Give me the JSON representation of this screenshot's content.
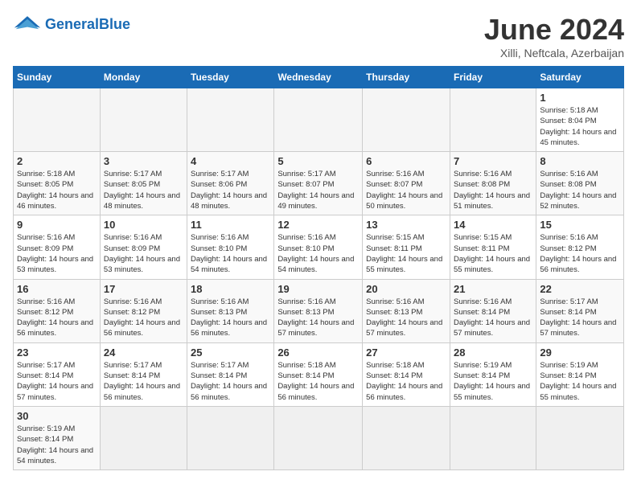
{
  "logo": {
    "text_general": "General",
    "text_blue": "Blue"
  },
  "title": "June 2024",
  "subtitle": "Xilli, Neftcala, Azerbaijan",
  "days_of_week": [
    "Sunday",
    "Monday",
    "Tuesday",
    "Wednesday",
    "Thursday",
    "Friday",
    "Saturday"
  ],
  "weeks": [
    [
      {
        "day": "",
        "empty": true
      },
      {
        "day": "",
        "empty": true
      },
      {
        "day": "",
        "empty": true
      },
      {
        "day": "",
        "empty": true
      },
      {
        "day": "",
        "empty": true
      },
      {
        "day": "",
        "empty": true
      },
      {
        "day": "1",
        "sunrise": "5:18 AM",
        "sunset": "8:04 PM",
        "daylight": "14 hours and 45 minutes."
      }
    ],
    [
      {
        "day": "2",
        "sunrise": "5:18 AM",
        "sunset": "8:05 PM",
        "daylight": "14 hours and 46 minutes."
      },
      {
        "day": "3",
        "sunrise": "5:17 AM",
        "sunset": "8:05 PM",
        "daylight": "14 hours and 48 minutes."
      },
      {
        "day": "4",
        "sunrise": "5:17 AM",
        "sunset": "8:06 PM",
        "daylight": "14 hours and 48 minutes."
      },
      {
        "day": "5",
        "sunrise": "5:17 AM",
        "sunset": "8:07 PM",
        "daylight": "14 hours and 49 minutes."
      },
      {
        "day": "6",
        "sunrise": "5:16 AM",
        "sunset": "8:07 PM",
        "daylight": "14 hours and 50 minutes."
      },
      {
        "day": "7",
        "sunrise": "5:16 AM",
        "sunset": "8:08 PM",
        "daylight": "14 hours and 51 minutes."
      },
      {
        "day": "8",
        "sunrise": "5:16 AM",
        "sunset": "8:08 PM",
        "daylight": "14 hours and 52 minutes."
      }
    ],
    [
      {
        "day": "9",
        "sunrise": "5:16 AM",
        "sunset": "8:09 PM",
        "daylight": "14 hours and 53 minutes."
      },
      {
        "day": "10",
        "sunrise": "5:16 AM",
        "sunset": "8:09 PM",
        "daylight": "14 hours and 53 minutes."
      },
      {
        "day": "11",
        "sunrise": "5:16 AM",
        "sunset": "8:10 PM",
        "daylight": "14 hours and 54 minutes."
      },
      {
        "day": "12",
        "sunrise": "5:16 AM",
        "sunset": "8:10 PM",
        "daylight": "14 hours and 54 minutes."
      },
      {
        "day": "13",
        "sunrise": "5:15 AM",
        "sunset": "8:11 PM",
        "daylight": "14 hours and 55 minutes."
      },
      {
        "day": "14",
        "sunrise": "5:15 AM",
        "sunset": "8:11 PM",
        "daylight": "14 hours and 55 minutes."
      },
      {
        "day": "15",
        "sunrise": "5:16 AM",
        "sunset": "8:12 PM",
        "daylight": "14 hours and 56 minutes."
      }
    ],
    [
      {
        "day": "16",
        "sunrise": "5:16 AM",
        "sunset": "8:12 PM",
        "daylight": "14 hours and 56 minutes."
      },
      {
        "day": "17",
        "sunrise": "5:16 AM",
        "sunset": "8:12 PM",
        "daylight": "14 hours and 56 minutes."
      },
      {
        "day": "18",
        "sunrise": "5:16 AM",
        "sunset": "8:13 PM",
        "daylight": "14 hours and 56 minutes."
      },
      {
        "day": "19",
        "sunrise": "5:16 AM",
        "sunset": "8:13 PM",
        "daylight": "14 hours and 57 minutes."
      },
      {
        "day": "20",
        "sunrise": "5:16 AM",
        "sunset": "8:13 PM",
        "daylight": "14 hours and 57 minutes."
      },
      {
        "day": "21",
        "sunrise": "5:16 AM",
        "sunset": "8:14 PM",
        "daylight": "14 hours and 57 minutes."
      },
      {
        "day": "22",
        "sunrise": "5:17 AM",
        "sunset": "8:14 PM",
        "daylight": "14 hours and 57 minutes."
      }
    ],
    [
      {
        "day": "23",
        "sunrise": "5:17 AM",
        "sunset": "8:14 PM",
        "daylight": "14 hours and 57 minutes."
      },
      {
        "day": "24",
        "sunrise": "5:17 AM",
        "sunset": "8:14 PM",
        "daylight": "14 hours and 56 minutes."
      },
      {
        "day": "25",
        "sunrise": "5:17 AM",
        "sunset": "8:14 PM",
        "daylight": "14 hours and 56 minutes."
      },
      {
        "day": "26",
        "sunrise": "5:18 AM",
        "sunset": "8:14 PM",
        "daylight": "14 hours and 56 minutes."
      },
      {
        "day": "27",
        "sunrise": "5:18 AM",
        "sunset": "8:14 PM",
        "daylight": "14 hours and 56 minutes."
      },
      {
        "day": "28",
        "sunrise": "5:19 AM",
        "sunset": "8:14 PM",
        "daylight": "14 hours and 55 minutes."
      },
      {
        "day": "29",
        "sunrise": "5:19 AM",
        "sunset": "8:14 PM",
        "daylight": "14 hours and 55 minutes."
      }
    ],
    [
      {
        "day": "30",
        "sunrise": "5:19 AM",
        "sunset": "8:14 PM",
        "daylight": "14 hours and 54 minutes."
      },
      {
        "day": "",
        "empty": true
      },
      {
        "day": "",
        "empty": true
      },
      {
        "day": "",
        "empty": true
      },
      {
        "day": "",
        "empty": true
      },
      {
        "day": "",
        "empty": true
      },
      {
        "day": "",
        "empty": true
      }
    ]
  ]
}
